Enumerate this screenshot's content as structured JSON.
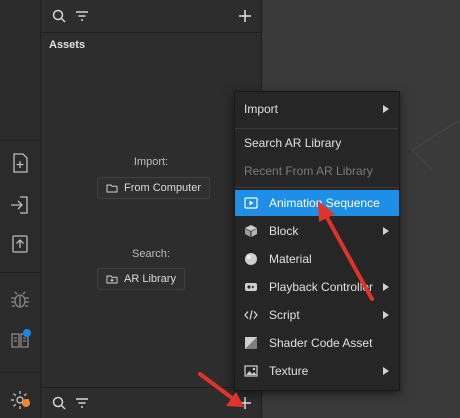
{
  "rail": {
    "icons": [
      "add-file-icon",
      "import-icon",
      "export-icon",
      "bug-icon",
      "book-icon",
      "settings-icon"
    ],
    "badge_color": "#1a86e8",
    "settings_badge_color": "#f0883a"
  },
  "panel": {
    "title": "Assets",
    "import_label": "Import:",
    "from_computer": "From Computer",
    "search_label": "Search:",
    "ar_library": "AR Library"
  },
  "menu": {
    "items": [
      {
        "label": "Import",
        "submenu": true
      },
      {
        "label": "Search AR Library"
      },
      {
        "label": "Recent From AR Library",
        "disabled": true
      },
      {
        "label": "Animation Sequence",
        "icon": "play-icon",
        "selected": true
      },
      {
        "label": "Block",
        "icon": "cube-icon",
        "submenu": true
      },
      {
        "label": "Material",
        "icon": "sphere-icon"
      },
      {
        "label": "Playback Controller",
        "icon": "playback-icon",
        "submenu": true
      },
      {
        "label": "Script",
        "icon": "code-icon",
        "submenu": true
      },
      {
        "label": "Shader Code Asset",
        "icon": "shader-icon"
      },
      {
        "label": "Texture",
        "icon": "image-icon",
        "submenu": true
      }
    ],
    "selected_color": "#1f8ee6"
  },
  "annotation_color": "#e0342b"
}
